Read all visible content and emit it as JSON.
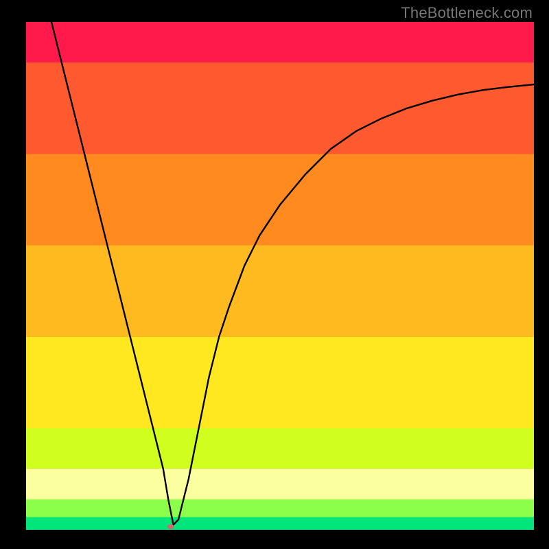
{
  "brand": "TheBottleneck.com",
  "chart_data": {
    "type": "line",
    "title": "",
    "xlabel": "",
    "ylabel": "",
    "xlim": [
      0,
      100
    ],
    "ylim": [
      0,
      100
    ],
    "grid": false,
    "legend": false,
    "bands": [
      {
        "name": "red-top",
        "color": "#ff1a4b",
        "y_from": 100,
        "y_to": 92
      },
      {
        "name": "red-orange",
        "color": "#ff5a2f",
        "y_from": 92,
        "y_to": 74
      },
      {
        "name": "orange",
        "color": "#ff8a1f",
        "y_from": 74,
        "y_to": 56
      },
      {
        "name": "amber",
        "color": "#ffba1f",
        "y_from": 56,
        "y_to": 38
      },
      {
        "name": "yellow",
        "color": "#ffe81f",
        "y_from": 38,
        "y_to": 20
      },
      {
        "name": "yellow-green",
        "color": "#d0ff1f",
        "y_from": 20,
        "y_to": 12
      },
      {
        "name": "pale-yellow",
        "color": "#fcffa0",
        "y_from": 12,
        "y_to": 6
      },
      {
        "name": "lime",
        "color": "#8cff4a",
        "y_from": 6,
        "y_to": 2.5
      },
      {
        "name": "green",
        "color": "#00e67a",
        "y_from": 2.5,
        "y_to": 0
      }
    ],
    "series": [
      {
        "name": "curve",
        "type": "line",
        "x": [
          5,
          8,
          10,
          12,
          15,
          18,
          20,
          22,
          24,
          26,
          27,
          28,
          29,
          30,
          32,
          34,
          36,
          38,
          40,
          43,
          46,
          50,
          55,
          60,
          65,
          70,
          75,
          80,
          85,
          90,
          95,
          100
        ],
        "y": [
          100,
          88,
          80,
          72,
          60,
          48,
          40,
          32,
          24,
          16,
          12,
          6,
          1,
          2,
          10,
          20,
          30,
          38,
          44,
          52,
          58,
          64,
          70,
          75,
          78.5,
          81,
          83,
          84.5,
          85.7,
          86.6,
          87.2,
          87.7
        ]
      }
    ],
    "marker": {
      "x": 28.5,
      "y": 0.6,
      "color": "#cc6b6b",
      "rx": 5,
      "ry": 3.5
    }
  }
}
